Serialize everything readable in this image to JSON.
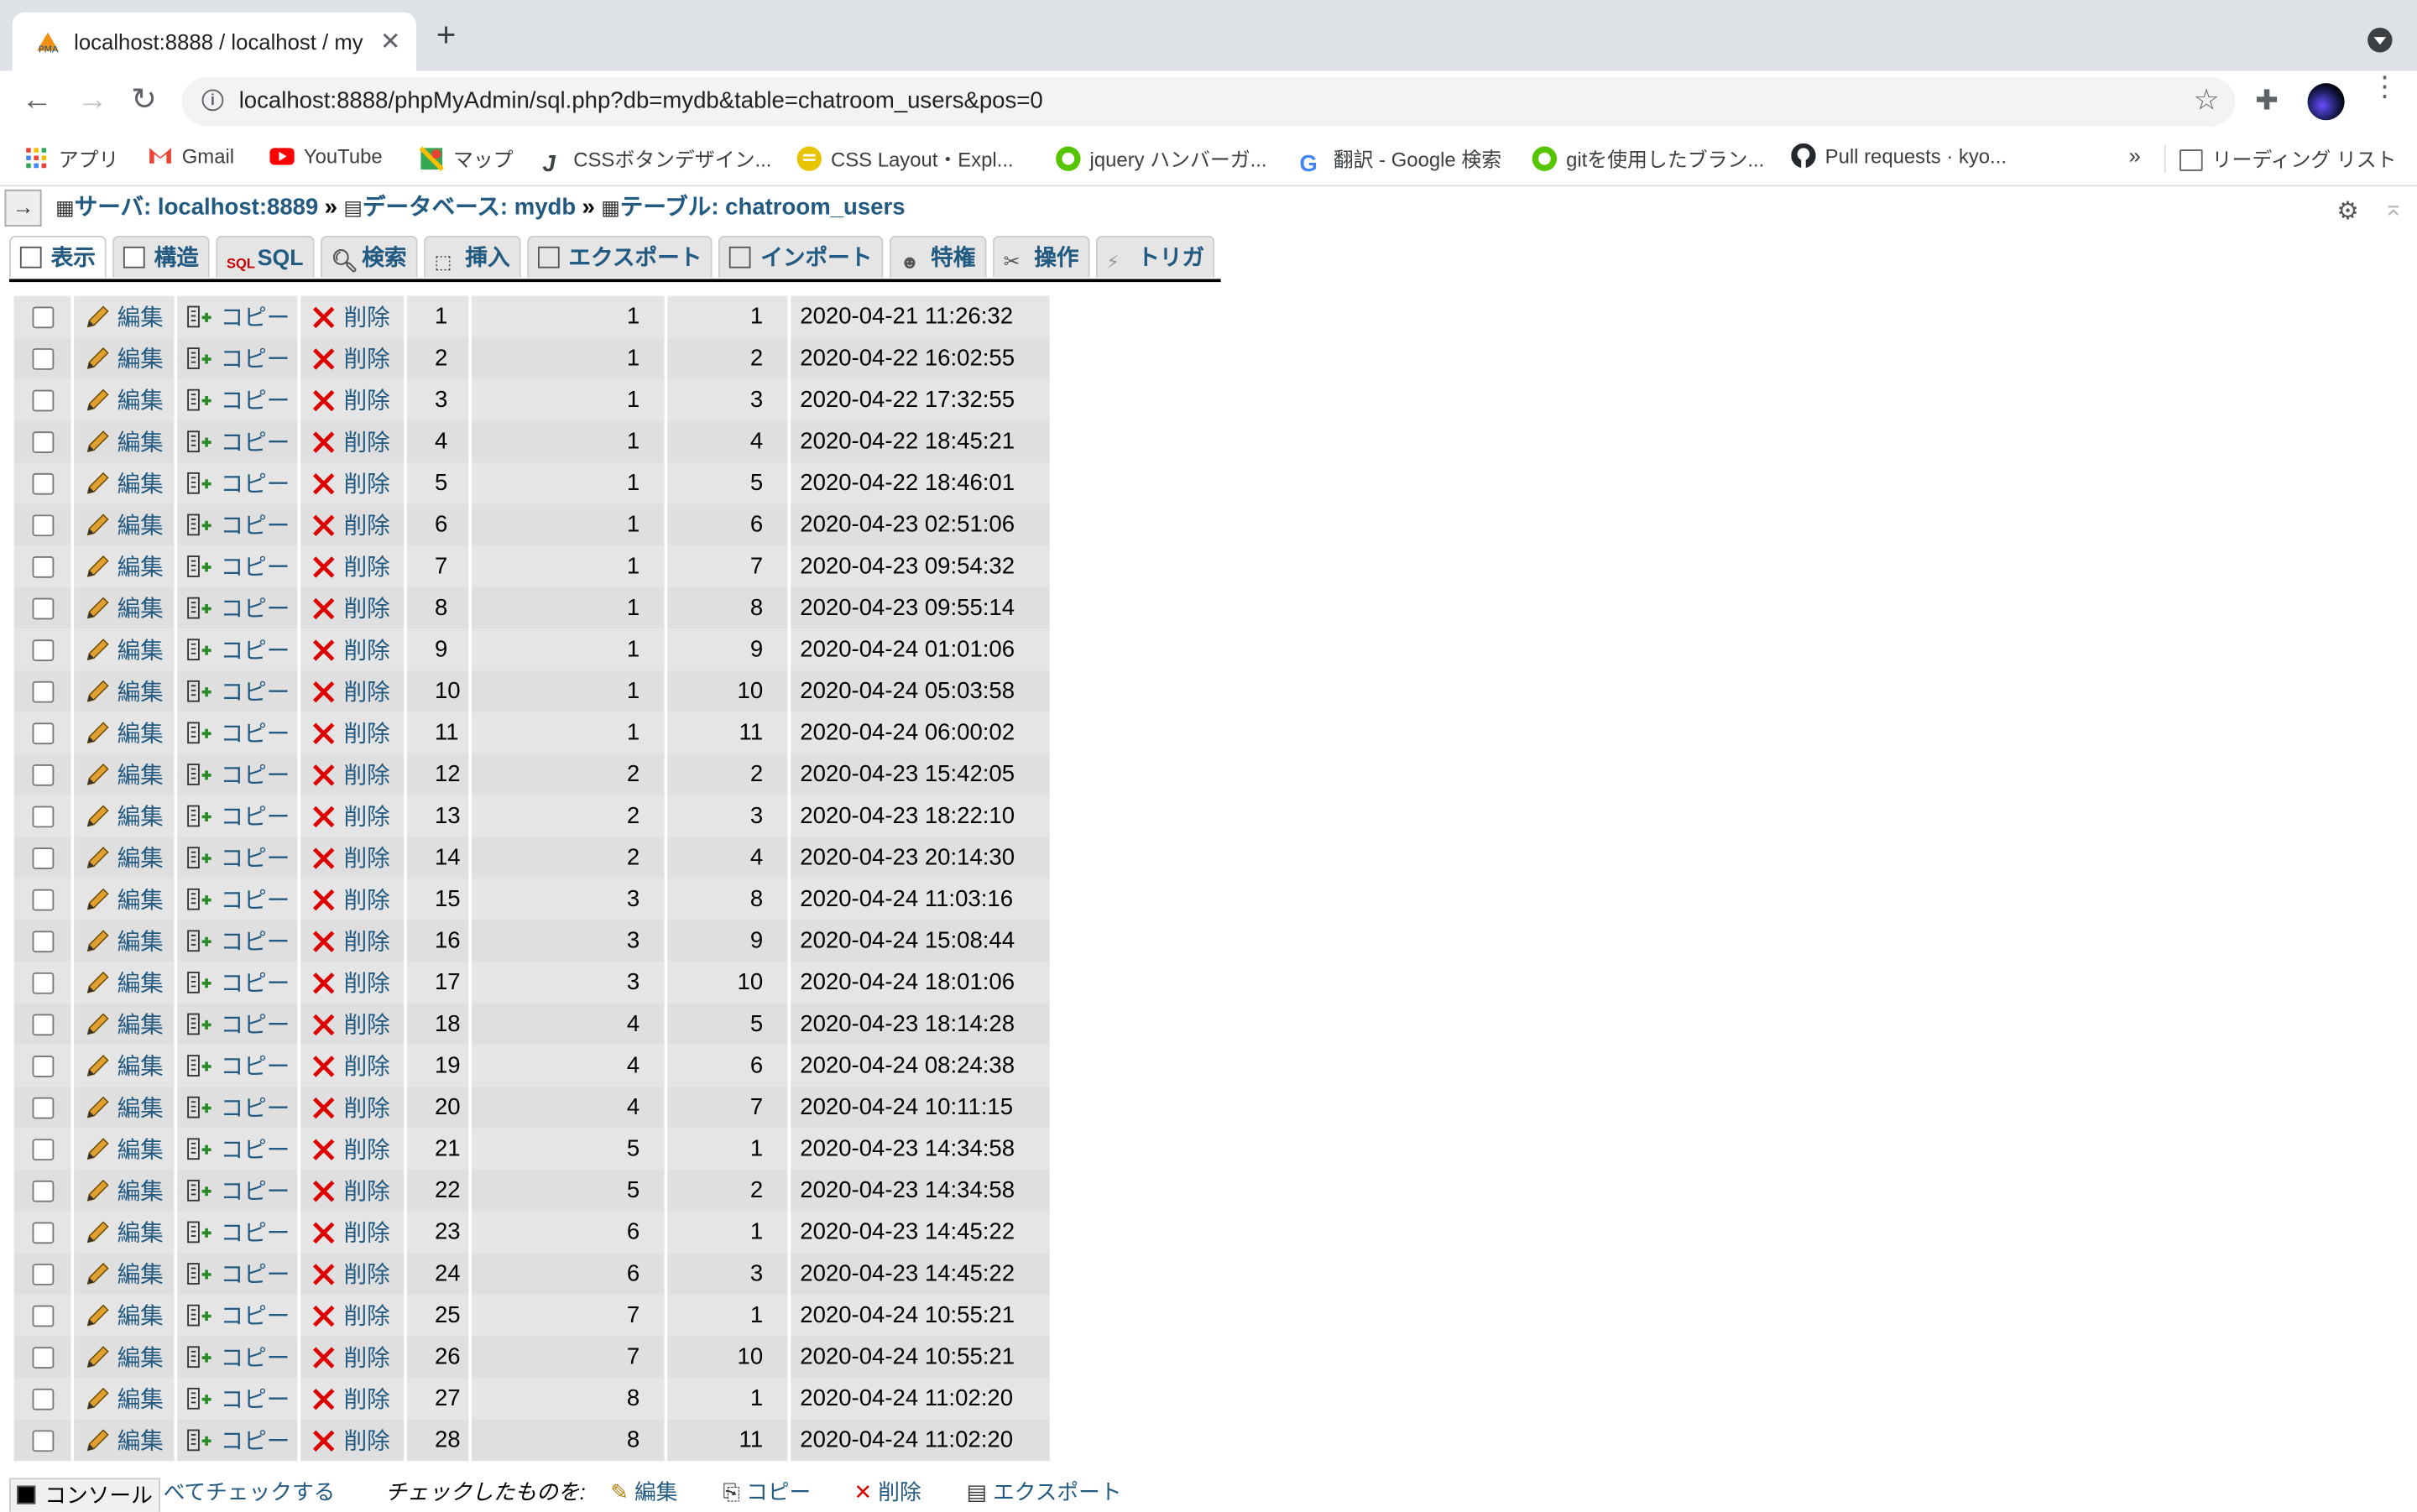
{
  "browser": {
    "tab_title": "localhost:8888 / localhost / my",
    "url": "localhost:8888/phpMyAdmin/sql.php?db=mydb&table=chatroom_users&pos=0",
    "bookmarks": [
      {
        "label": "アプリ"
      },
      {
        "label": "Gmail"
      },
      {
        "label": "YouTube"
      },
      {
        "label": "マップ"
      },
      {
        "label": "CSSボタンデザイン..."
      },
      {
        "label": "CSS Layout・Expl..."
      },
      {
        "label": "jquery ハンバーガ..."
      },
      {
        "label": "翻訳 - Google 検索"
      },
      {
        "label": "gitを使用したブラン..."
      },
      {
        "label": "Pull requests · kyo..."
      }
    ],
    "more": "»",
    "reading_list": "リーディング リスト"
  },
  "breadcrumb": {
    "server": "サーバ: localhost:8889",
    "database": "データベース: mydb",
    "table": "テーブル: chatroom_users",
    "sep": "»"
  },
  "tabs": [
    {
      "label": "表示"
    },
    {
      "label": "構造"
    },
    {
      "label": "SQL"
    },
    {
      "label": "検索"
    },
    {
      "label": "挿入"
    },
    {
      "label": "エクスポート"
    },
    {
      "label": "インポート"
    },
    {
      "label": "特権"
    },
    {
      "label": "操作"
    },
    {
      "label": "トリガ"
    }
  ],
  "actions": {
    "edit": "編集",
    "copy": "コピー",
    "delete": "削除"
  },
  "rows": [
    {
      "id": "1",
      "chat_room_id": "1",
      "user_id": "1",
      "participant_at": "2020-04-21 11:26:32"
    },
    {
      "id": "2",
      "chat_room_id": "1",
      "user_id": "2",
      "participant_at": "2020-04-22 16:02:55"
    },
    {
      "id": "3",
      "chat_room_id": "1",
      "user_id": "3",
      "participant_at": "2020-04-22 17:32:55"
    },
    {
      "id": "4",
      "chat_room_id": "1",
      "user_id": "4",
      "participant_at": "2020-04-22 18:45:21"
    },
    {
      "id": "5",
      "chat_room_id": "1",
      "user_id": "5",
      "participant_at": "2020-04-22 18:46:01"
    },
    {
      "id": "6",
      "chat_room_id": "1",
      "user_id": "6",
      "participant_at": "2020-04-23 02:51:06"
    },
    {
      "id": "7",
      "chat_room_id": "1",
      "user_id": "7",
      "participant_at": "2020-04-23 09:54:32"
    },
    {
      "id": "8",
      "chat_room_id": "1",
      "user_id": "8",
      "participant_at": "2020-04-23 09:55:14"
    },
    {
      "id": "9",
      "chat_room_id": "1",
      "user_id": "9",
      "participant_at": "2020-04-24 01:01:06"
    },
    {
      "id": "10",
      "chat_room_id": "1",
      "user_id": "10",
      "participant_at": "2020-04-24 05:03:58"
    },
    {
      "id": "11",
      "chat_room_id": "1",
      "user_id": "11",
      "participant_at": "2020-04-24 06:00:02"
    },
    {
      "id": "12",
      "chat_room_id": "2",
      "user_id": "2",
      "participant_at": "2020-04-23 15:42:05"
    },
    {
      "id": "13",
      "chat_room_id": "2",
      "user_id": "3",
      "participant_at": "2020-04-23 18:22:10"
    },
    {
      "id": "14",
      "chat_room_id": "2",
      "user_id": "4",
      "participant_at": "2020-04-23 20:14:30"
    },
    {
      "id": "15",
      "chat_room_id": "3",
      "user_id": "8",
      "participant_at": "2020-04-24 11:03:16"
    },
    {
      "id": "16",
      "chat_room_id": "3",
      "user_id": "9",
      "participant_at": "2020-04-24 15:08:44"
    },
    {
      "id": "17",
      "chat_room_id": "3",
      "user_id": "10",
      "participant_at": "2020-04-24 18:01:06"
    },
    {
      "id": "18",
      "chat_room_id": "4",
      "user_id": "5",
      "participant_at": "2020-04-23 18:14:28"
    },
    {
      "id": "19",
      "chat_room_id": "4",
      "user_id": "6",
      "participant_at": "2020-04-24 08:24:38"
    },
    {
      "id": "20",
      "chat_room_id": "4",
      "user_id": "7",
      "participant_at": "2020-04-24 10:11:15"
    },
    {
      "id": "21",
      "chat_room_id": "5",
      "user_id": "1",
      "participant_at": "2020-04-23 14:34:58"
    },
    {
      "id": "22",
      "chat_room_id": "5",
      "user_id": "2",
      "participant_at": "2020-04-23 14:34:58"
    },
    {
      "id": "23",
      "chat_room_id": "6",
      "user_id": "1",
      "participant_at": "2020-04-23 14:45:22"
    },
    {
      "id": "24",
      "chat_room_id": "6",
      "user_id": "3",
      "participant_at": "2020-04-23 14:45:22"
    },
    {
      "id": "25",
      "chat_room_id": "7",
      "user_id": "1",
      "participant_at": "2020-04-24 10:55:21"
    },
    {
      "id": "26",
      "chat_room_id": "7",
      "user_id": "10",
      "participant_at": "2020-04-24 10:55:21"
    },
    {
      "id": "27",
      "chat_room_id": "8",
      "user_id": "1",
      "participant_at": "2020-04-24 11:02:20"
    },
    {
      "id": "28",
      "chat_room_id": "8",
      "user_id": "11",
      "participant_at": "2020-04-24 11:02:20"
    }
  ],
  "footer": {
    "console": "コンソール",
    "check_all": "べてチェックする",
    "with_selected": "チェックしたものを:",
    "edit": "編集",
    "copy": "コピー",
    "delete": "削除",
    "export": "エクスポート"
  },
  "colors": {
    "link": "#235a81",
    "row_alt": "#dfdfdf",
    "row": "#e5e5e5"
  }
}
